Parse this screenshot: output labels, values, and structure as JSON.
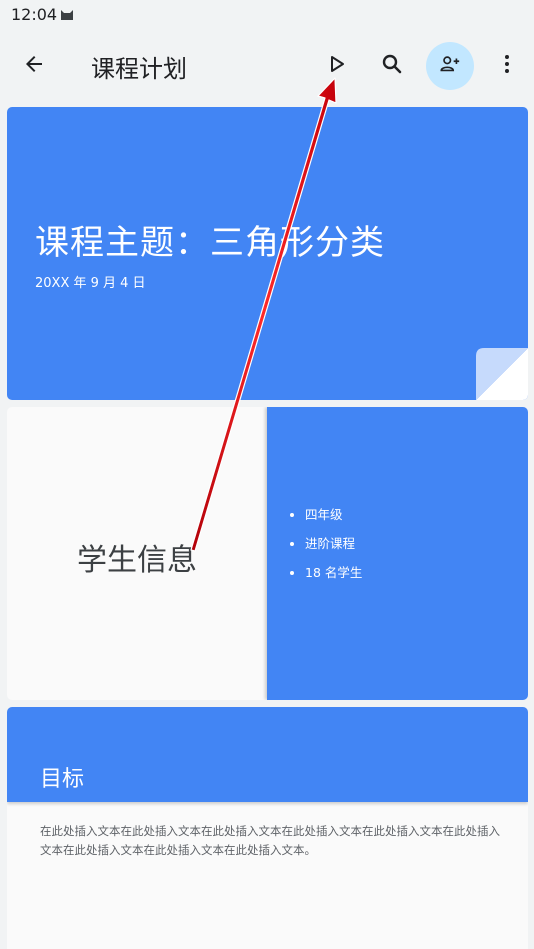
{
  "status": {
    "time": "12:04"
  },
  "appbar": {
    "title": "课程计划",
    "icons": {
      "back": "arrow-back-icon",
      "play": "play-icon",
      "search": "search-icon",
      "share": "person-add-icon",
      "more": "more-vert-icon"
    },
    "share_bg": "#c2e7ff"
  },
  "slides": [
    {
      "title": "课程主题：三角形分类",
      "subtitle": "20XX 年 9 月 4 日"
    },
    {
      "left_title": "学生信息",
      "bullets": [
        "四年级",
        "进阶课程",
        "18 名学生"
      ]
    },
    {
      "title": "目标",
      "body": "在此处插入文本在此处插入文本在此处插入文本在此处插入文本在此处插入文本在此处插入文本在此处插入文本在此处插入文本在此处插入文本。"
    }
  ],
  "colors": {
    "accent": "#4285f4",
    "background": "#f1f3f4",
    "annotation_arrow": "#e8141b"
  }
}
